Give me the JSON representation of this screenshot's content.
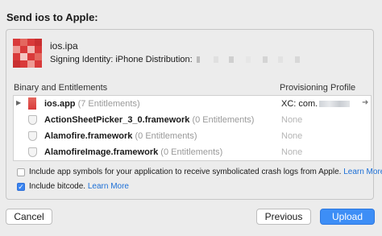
{
  "dialog": {
    "title": "Send ios to Apple:"
  },
  "archive": {
    "name": "ios.ipa",
    "signing_label": "Signing Identity: iPhone Distribution:"
  },
  "table": {
    "col_left": "Binary and Entitlements",
    "col_right": "Provisioning Profile",
    "rows": [
      {
        "name": "ios.app",
        "entitlements": "(7 Entitlements)",
        "profile": "XC: com.",
        "expanded": false
      },
      {
        "name": "ActionSheetPicker_3_0.framework",
        "entitlements": "(0 Entitlements)",
        "profile": "None"
      },
      {
        "name": "Alamofire.framework",
        "entitlements": "(0 Entitlements)",
        "profile": "None"
      },
      {
        "name": "AlamofireImage.framework",
        "entitlements": "(0 Entitlements)",
        "profile": "None"
      }
    ]
  },
  "options": {
    "symbols_label": "Include app symbols for your application to receive symbolicated crash logs from Apple.",
    "symbols_link": "Learn More",
    "symbols_checked": false,
    "bitcode_label": "Include bitcode.",
    "bitcode_link": "Learn More",
    "bitcode_checked": true
  },
  "buttons": {
    "cancel": "Cancel",
    "previous": "Previous",
    "upload": "Upload"
  },
  "colors": {
    "accent": "#3d8ef6",
    "link": "#1c6fd6",
    "icon_red": "#d9393a"
  }
}
